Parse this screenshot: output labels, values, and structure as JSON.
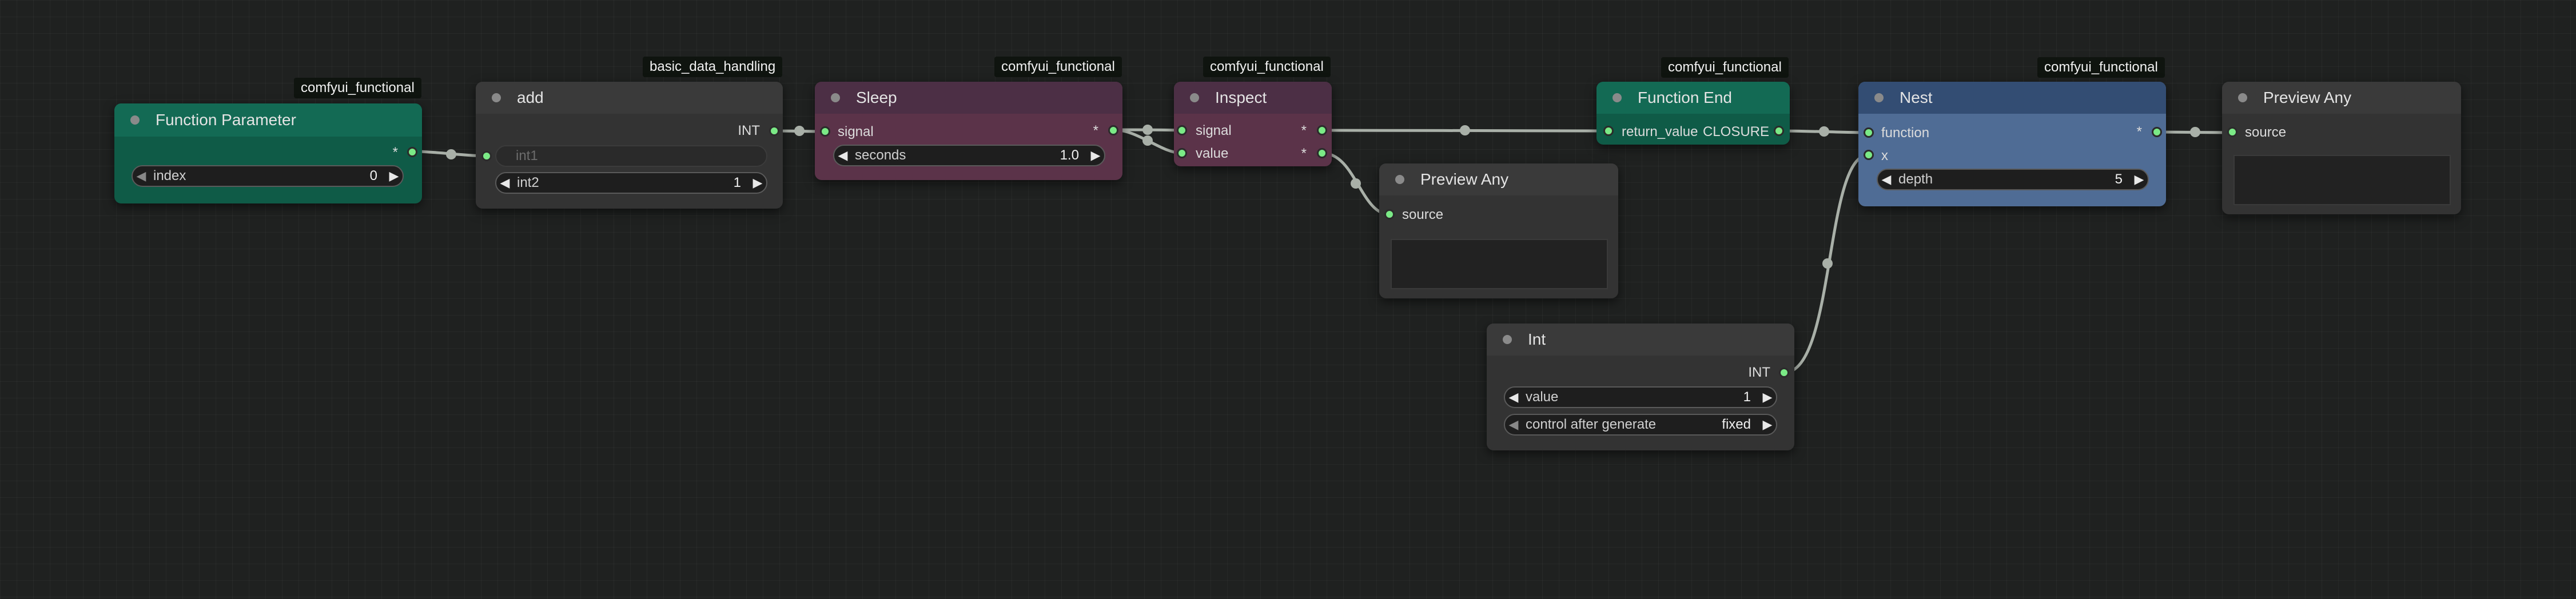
{
  "colors": {
    "canvas": "#1f2120",
    "link": "#a9b0a8",
    "socket": "#7bea86",
    "green_header": "#136a54",
    "green_body": "#0f5b47",
    "gray_header": "#3a3a3a",
    "gray_body": "#333333",
    "plum_header": "#4c2f45",
    "plum_body": "#5b3349",
    "blue_header": "#334d73",
    "blue_body": "#4f6c95"
  },
  "nodes": {
    "function_parameter": {
      "badge": "comfyui_functional",
      "title": "Function Parameter",
      "output_label": "*",
      "widget": {
        "label": "index",
        "value": "0"
      }
    },
    "add": {
      "badge": "basic_data_handling",
      "title": "add",
      "output_label": "INT",
      "input_int1": "int1",
      "widget": {
        "label": "int2",
        "value": "1"
      }
    },
    "sleep": {
      "badge": "comfyui_functional",
      "title": "Sleep",
      "input_signal": "signal",
      "output_label": "*",
      "widget": {
        "label": "seconds",
        "value": "1.0"
      }
    },
    "inspect": {
      "badge": "comfyui_functional",
      "title": "Inspect",
      "input_signal": "signal",
      "input_value": "value",
      "output_signal": "*",
      "output_value": "*"
    },
    "preview_any_1": {
      "title": "Preview Any",
      "input_source": "source"
    },
    "function_end": {
      "badge": "comfyui_functional",
      "title": "Function End",
      "input_return": "return_value",
      "output_label": "CLOSURE"
    },
    "nest": {
      "badge": "comfyui_functional",
      "title": "Nest",
      "input_function": "function",
      "input_x": "x",
      "output_label": "*",
      "widget": {
        "label": "depth",
        "value": "5"
      }
    },
    "preview_any_2": {
      "title": "Preview Any",
      "input_source": "source"
    },
    "int": {
      "title": "Int",
      "output_label": "INT",
      "widget_value": {
        "label": "value",
        "value": "1"
      },
      "widget_control": {
        "label": "control after generate",
        "value": "fixed"
      }
    }
  },
  "icons": {
    "decrement": "◀",
    "increment": "▶"
  }
}
